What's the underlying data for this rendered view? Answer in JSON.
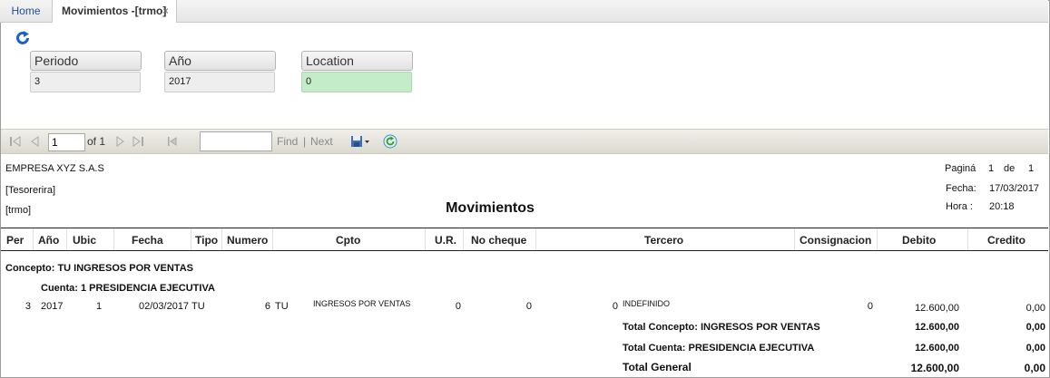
{
  "tabs": {
    "home": "Home",
    "active": "Movimientos -[trmo]",
    "close": "×"
  },
  "filters": [
    {
      "label": "Periodo",
      "value": "3"
    },
    {
      "label": "Año",
      "value": "2017"
    },
    {
      "label": "Location",
      "value": "0"
    }
  ],
  "toolbar": {
    "page_value": "1",
    "of_text": "of 1",
    "find": "Find",
    "separator": "|",
    "next": "Next"
  },
  "report": {
    "company": "EMPRESA XYZ S.A.S",
    "dept": "[Tesorerira]",
    "code": "[trmo]",
    "title": "Movimientos",
    "pagina_label": "Paginá",
    "pagina_num": "1",
    "de_label": "de",
    "pagina_total": "1",
    "fecha_label": "Fecha:",
    "fecha_value": "17/03/2017",
    "hora_label": "Hora :",
    "hora_value": "20:18",
    "columns": [
      "Per",
      "Año",
      "Ubic",
      "Fecha",
      "Tipo",
      "Numero",
      "Cpto",
      "U.R.",
      "No cheque",
      "Tercero",
      "Consignacion",
      "Debito",
      "Credito"
    ],
    "concepto": "Concepto: TU  INGRESOS POR VENTAS",
    "cuenta": "Cuenta: 1 PRESIDENCIA EJECUTIVA",
    "row": {
      "per": "3",
      "anio": "2017",
      "ubic": "1",
      "fecha": "02/03/2017",
      "tipo": "TU",
      "numero": "6",
      "numero_tipo": "TU",
      "cpto": "INGRESOS POR VENTAS",
      "ur": "0",
      "cheque": "0",
      "tercero_code": "0",
      "tercero": "INDEFINIDO",
      "consignacion": "0",
      "debito": "12.600,00",
      "credito": "0,00"
    },
    "totals": [
      {
        "label": "Total Concepto: INGRESOS POR VENTAS",
        "debito": "12.600,00",
        "credito": "0,00"
      },
      {
        "label": "Total Cuenta: PRESIDENCIA EJECUTIVA",
        "debito": "12.600,00",
        "credito": "0,00"
      },
      {
        "label": "Total General",
        "debito": "12.600,00",
        "credito": "0,00"
      }
    ]
  }
}
